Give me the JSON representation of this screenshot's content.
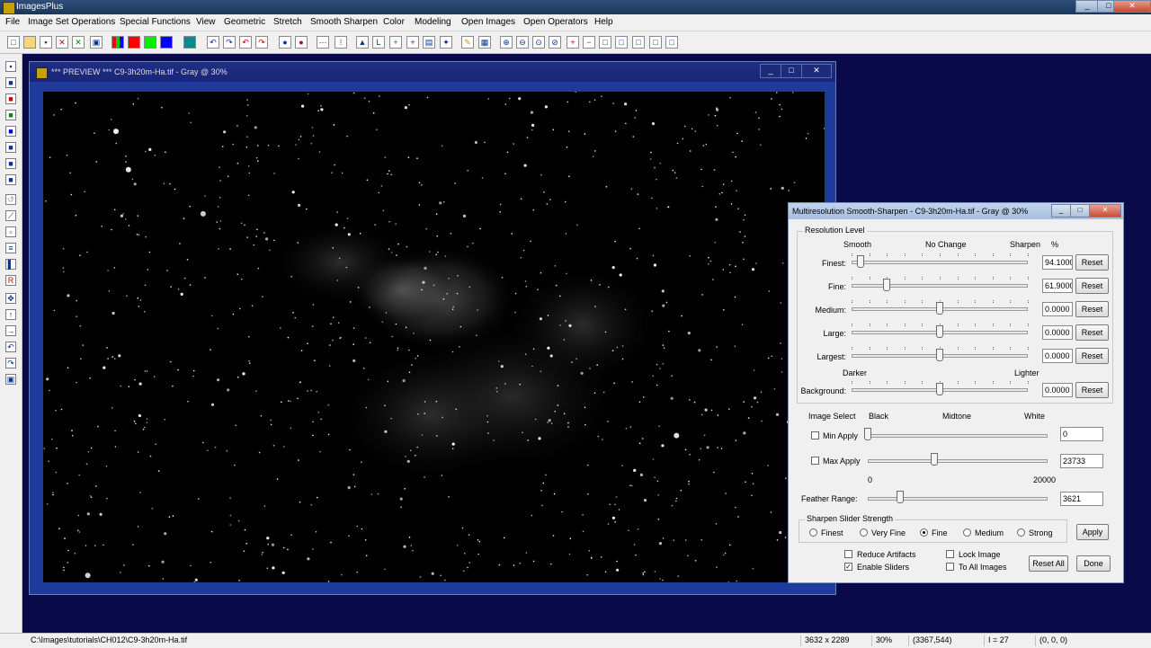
{
  "app": {
    "title": "ImagesPlus",
    "window_controls": [
      "_",
      "□",
      "✕"
    ]
  },
  "menu": [
    "File",
    "Image Set Operations",
    "Special Functions",
    "View",
    "Geometric",
    "Stretch",
    "Smooth Sharpen",
    "Color",
    "Modeling",
    "Open Images",
    "Open Operators",
    "Help"
  ],
  "toolbar_icons": [
    "new-icon",
    "open-icon",
    "save-icon",
    "close-red-icon",
    "close-green-icon",
    "copy-icon",
    "rgb-channels-icon",
    "red-channel-icon",
    "green-channel-icon",
    "blue-channel-icon",
    "grid-icon",
    "undo-icon",
    "redo-icon",
    "undo-all-icon",
    "redo-all-icon",
    "record-icon",
    "stop-icon",
    "dots-icon",
    "crosshair-icon",
    "triangle-icon",
    "axis-icon",
    "plus-icon",
    "cross-icon",
    "histogram-icon",
    "magic-icon",
    "pencil-icon",
    "palette-icon",
    "zoom-in-icon",
    "zoom-out-icon",
    "zoom-fit-icon",
    "zoom-actual-icon",
    "zoom-add-icon",
    "zoom-sub-icon",
    "frame1-icon",
    "frame2-icon",
    "frame3-icon",
    "frame4-icon",
    "frame5-icon"
  ],
  "preview": {
    "title": "*** PREVIEW *** C9-3h20m-Ha.tif - Gray @ 30%",
    "controls": [
      "_",
      "□",
      "✕"
    ]
  },
  "dialog": {
    "title": "Multiresolution Smooth-Sharpen - C9-3h20m-Ha.tif - Gray @ 30%",
    "controls": [
      "_",
      "□",
      "✕"
    ],
    "resolution_group": "Resolution Level",
    "headers": {
      "smooth": "Smooth",
      "no_change": "No Change",
      "sharpen": "Sharpen",
      "percent": "%"
    },
    "rows": [
      {
        "label": "Finest:",
        "value": "94.1000",
        "pos": 0.05,
        "reset": "Reset"
      },
      {
        "label": "Fine:",
        "value": "61.9000",
        "pos": 0.2,
        "reset": "Reset"
      },
      {
        "label": "Medium:",
        "value": "0.0000",
        "pos": 0.5,
        "reset": "Reset"
      },
      {
        "label": "Large:",
        "value": "0.0000",
        "pos": 0.5,
        "reset": "Reset"
      },
      {
        "label": "Largest:",
        "value": "0.0000",
        "pos": 0.5,
        "reset": "Reset"
      }
    ],
    "bg_headers": {
      "darker": "Darker",
      "lighter": "Lighter"
    },
    "background_row": {
      "label": "Background:",
      "value": "0.0000",
      "pos": 0.5,
      "reset": "Reset"
    },
    "image_select": {
      "label": "Image Select",
      "black": "Black",
      "midtone": "Midtone",
      "white": "White"
    },
    "min_apply": {
      "label": "Min Apply",
      "value": "0",
      "pos": 0.0,
      "checked": false
    },
    "max_apply": {
      "label": "Max Apply",
      "value": "23733",
      "pos": 0.37,
      "checked": false
    },
    "feather": {
      "label": "Feather Range:",
      "min": "0",
      "max": "20000",
      "value": "3621",
      "pos": 0.18
    },
    "strength_group": "Sharpen Slider Strength",
    "strengths": [
      {
        "label": "Finest",
        "selected": false
      },
      {
        "label": "Very Fine",
        "selected": false
      },
      {
        "label": "Fine",
        "selected": true
      },
      {
        "label": "Medium",
        "selected": false
      },
      {
        "label": "Strong",
        "selected": false
      }
    ],
    "apply": "Apply",
    "checkboxes": [
      {
        "label": "Reduce Artifacts",
        "checked": false
      },
      {
        "label": "Enable Sliders",
        "checked": true
      },
      {
        "label": "Lock Image",
        "checked": false
      },
      {
        "label": "To All Images",
        "checked": false
      }
    ],
    "reset_all": "Reset All",
    "done": "Done"
  },
  "status": {
    "path": "C:\\Images\\tutorials\\CH012\\C9-3h20m-Ha.tif",
    "dims": "3632 x 2289",
    "zoom": "30%",
    "coords": "(3367,544)",
    "intensity": "I = 27",
    "rgb": "(0, 0, 0)"
  }
}
